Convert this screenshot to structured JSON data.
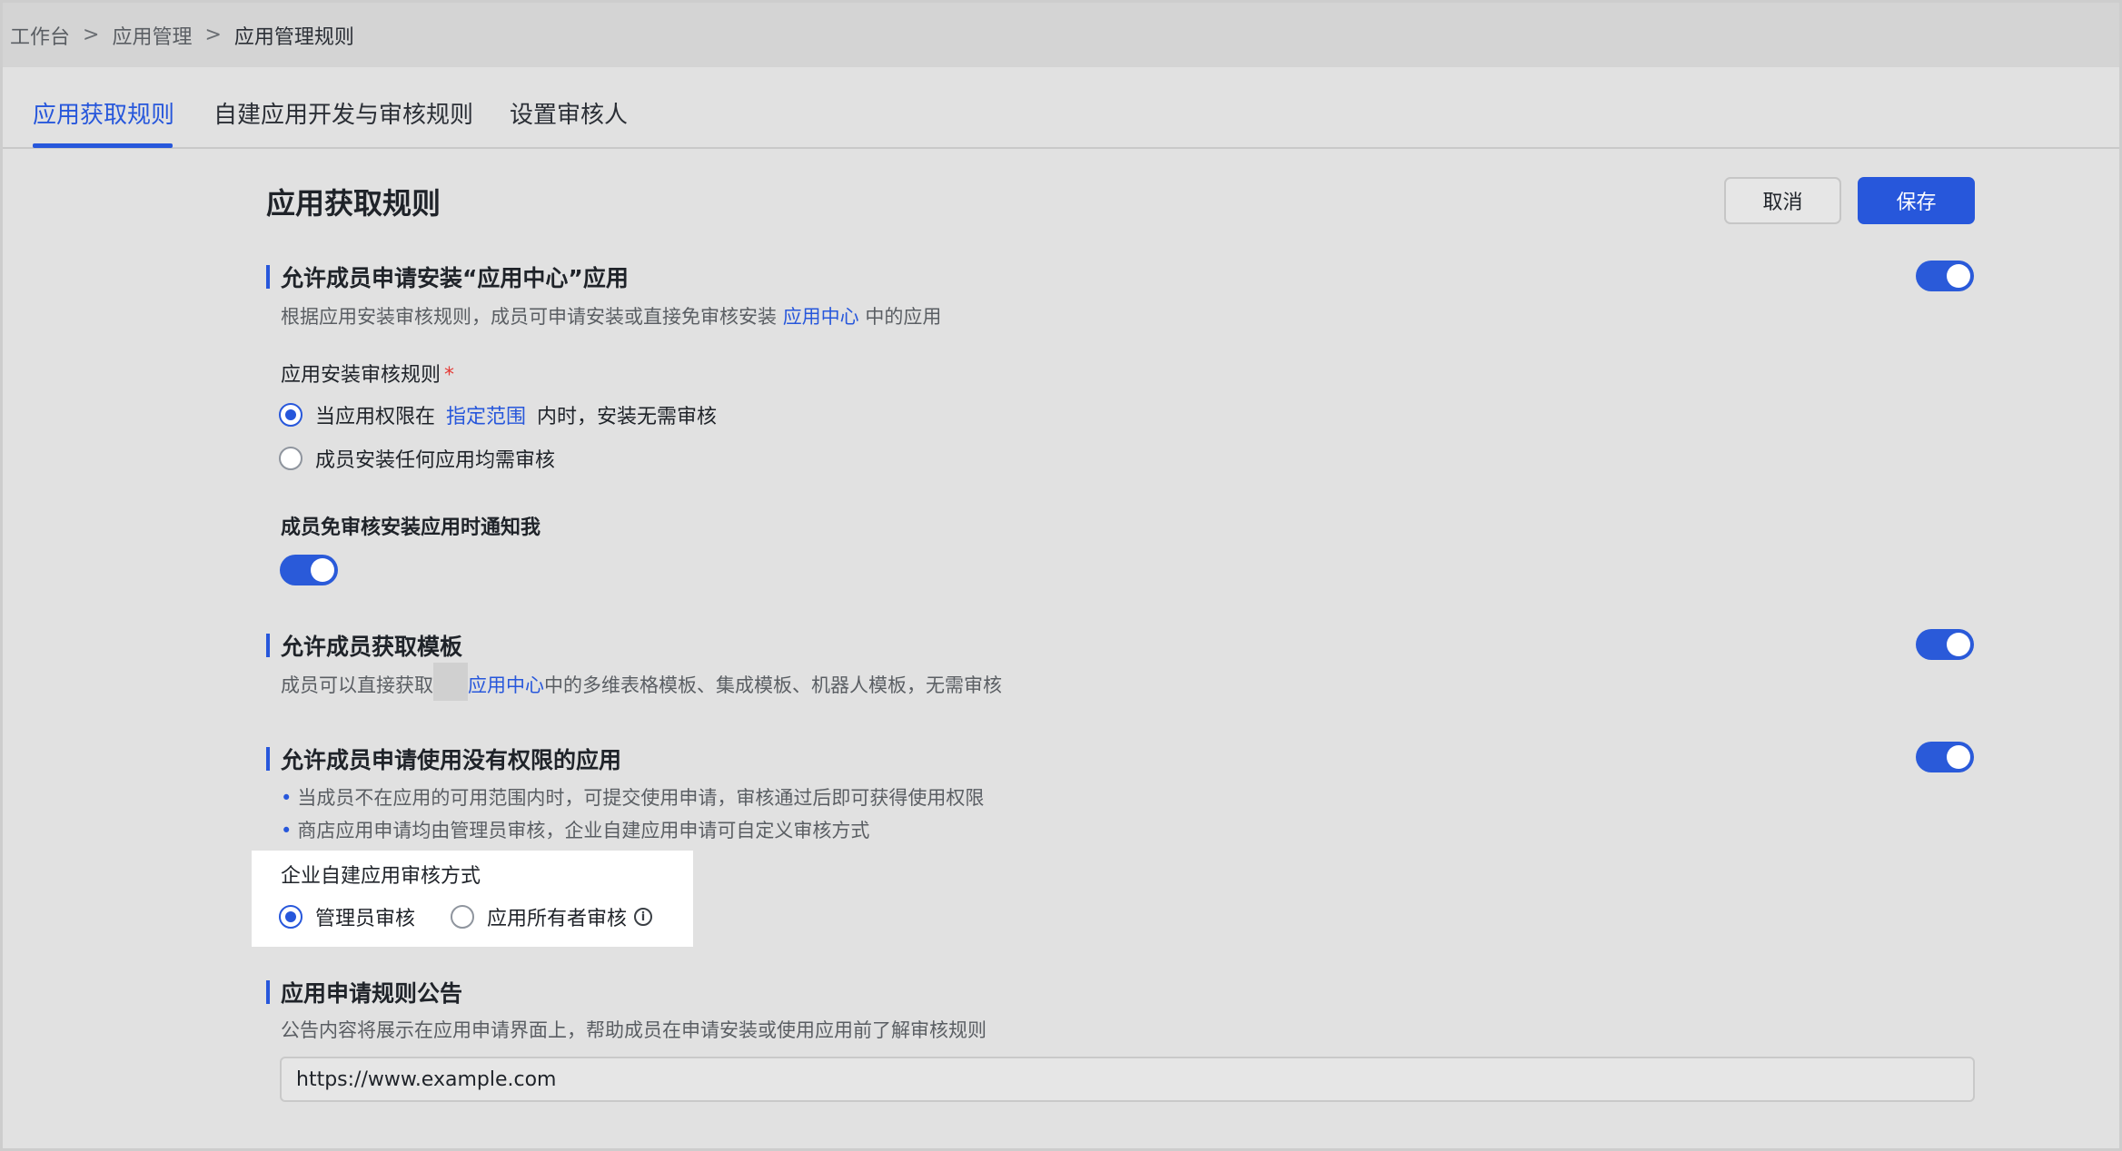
{
  "breadcrumb": {
    "items": [
      "工作台",
      "应用管理",
      "应用管理规则"
    ],
    "separator": ">"
  },
  "tabs": [
    {
      "label": "应用获取规则",
      "active": true
    },
    {
      "label": "自建应用开发与审核规则",
      "active": false
    },
    {
      "label": "设置审核人",
      "active": false
    }
  ],
  "page": {
    "title": "应用获取规则",
    "cancel_label": "取消",
    "save_label": "保存"
  },
  "section_install": {
    "title": "允许成员申请安装“应用中心”应用",
    "toggle_on": true,
    "desc_prefix": "根据应用安装审核规则，成员可申请安装或直接免审核安装",
    "desc_link": "应用中心",
    "desc_suffix": "中的应用",
    "rule_label": "应用安装审核规则",
    "required_mark": "*",
    "option1_prefix": "当应用权限在",
    "option1_link": "指定范围",
    "option1_suffix": "内时，安装无需审核",
    "option2": "成员安装任何应用均需审核",
    "selected_option": 1,
    "notify_label": "成员免审核安装应用时通知我",
    "notify_on": true
  },
  "section_template": {
    "title": "允许成员获取模板",
    "toggle_on": true,
    "desc_prefix": "成员可以直接获取",
    "desc_link": "应用中心",
    "desc_suffix": "中的多维表格模板、集成模板、机器人模板，无需审核"
  },
  "section_noperm": {
    "title": "允许成员申请使用没有权限的应用",
    "toggle_on": true,
    "bullet1": "当成员不在应用的可用范围内时，可提交使用申请，审核通过后即可获得使用权限",
    "bullet2": "商店应用申请均由管理员审核，企业自建应用申请可自定义审核方式",
    "review_label": "企业自建应用审核方式",
    "review_option1": "管理员审核",
    "review_option2": "应用所有者审核",
    "review_selected": 1
  },
  "section_notice": {
    "title": "应用申请规则公告",
    "desc": "公告内容将展示在应用申请界面上，帮助成员在申请安装或使用应用前了解审核规则",
    "input_value": "https://www.example.com"
  },
  "colors": {
    "accent": "#2757db",
    "required": "#e53a35"
  }
}
